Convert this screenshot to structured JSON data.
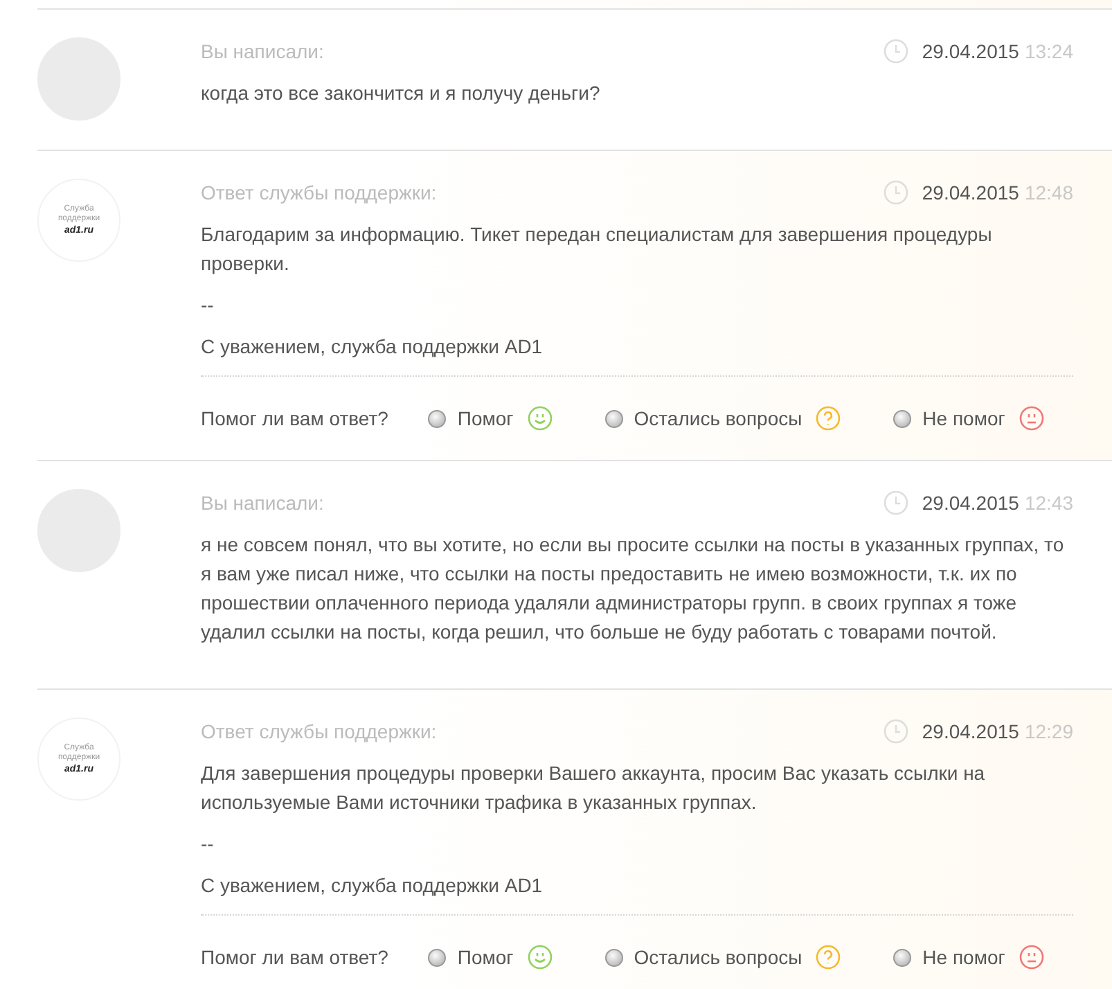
{
  "messages": [
    {
      "kind": "user",
      "label": "Вы написали:",
      "date": "29.04.2015",
      "time": "13:24",
      "paragraphs": [
        "когда это все закончится и я получу деньги?"
      ]
    },
    {
      "kind": "support",
      "label": "Ответ службы поддержки:",
      "date": "29.04.2015",
      "time": "12:48",
      "logo": {
        "line_1": "Служба",
        "line_2": "поддержки",
        "brand": "ad1.ru"
      },
      "paragraphs": [
        "Благодарим за информацию. Тикет передан специалистам для завершения процедуры проверки.",
        "--",
        "С уважением, служба поддержки AD1"
      ],
      "feedback": {
        "question": "Помог ли вам ответ?",
        "options": [
          {
            "label": "Помог",
            "kind": "good",
            "selected": false
          },
          {
            "label": "Остались вопросы",
            "kind": "question",
            "selected": false
          },
          {
            "label": "Не помог",
            "kind": "bad",
            "selected": false
          }
        ]
      }
    },
    {
      "kind": "user",
      "label": "Вы написали:",
      "date": "29.04.2015",
      "time": "12:43",
      "paragraphs": [
        "я не совсем понял, что вы хотите, но если вы просите ссылки на посты в указанных группах, то я вам уже писал ниже, что ссылки на посты предоставить не имею возможности, т.к. их по прошествии оплаченного периода удаляли администраторы групп. в своих группах я тоже удалил ссылки на посты, когда решил, что больше не буду работать с товарами почтой."
      ]
    },
    {
      "kind": "support",
      "label": "Ответ службы поддержки:",
      "date": "29.04.2015",
      "time": "12:29",
      "logo": {
        "line_1": "Служба",
        "line_2": "поддержки",
        "brand": "ad1.ru"
      },
      "paragraphs": [
        "Для завершения процедуры проверки Вашего аккаунта, просим Вас указать ссылки на используемые Вами источники трафика в указанных группах.",
        "--",
        "С уважением, служба поддержки AD1"
      ],
      "feedback": {
        "question": "Помог ли вам ответ?",
        "options": [
          {
            "label": "Помог",
            "kind": "good",
            "selected": false
          },
          {
            "label": "Остались вопросы",
            "kind": "question",
            "selected": false
          },
          {
            "label": "Не помог",
            "kind": "bad",
            "selected": false
          }
        ]
      }
    }
  ]
}
